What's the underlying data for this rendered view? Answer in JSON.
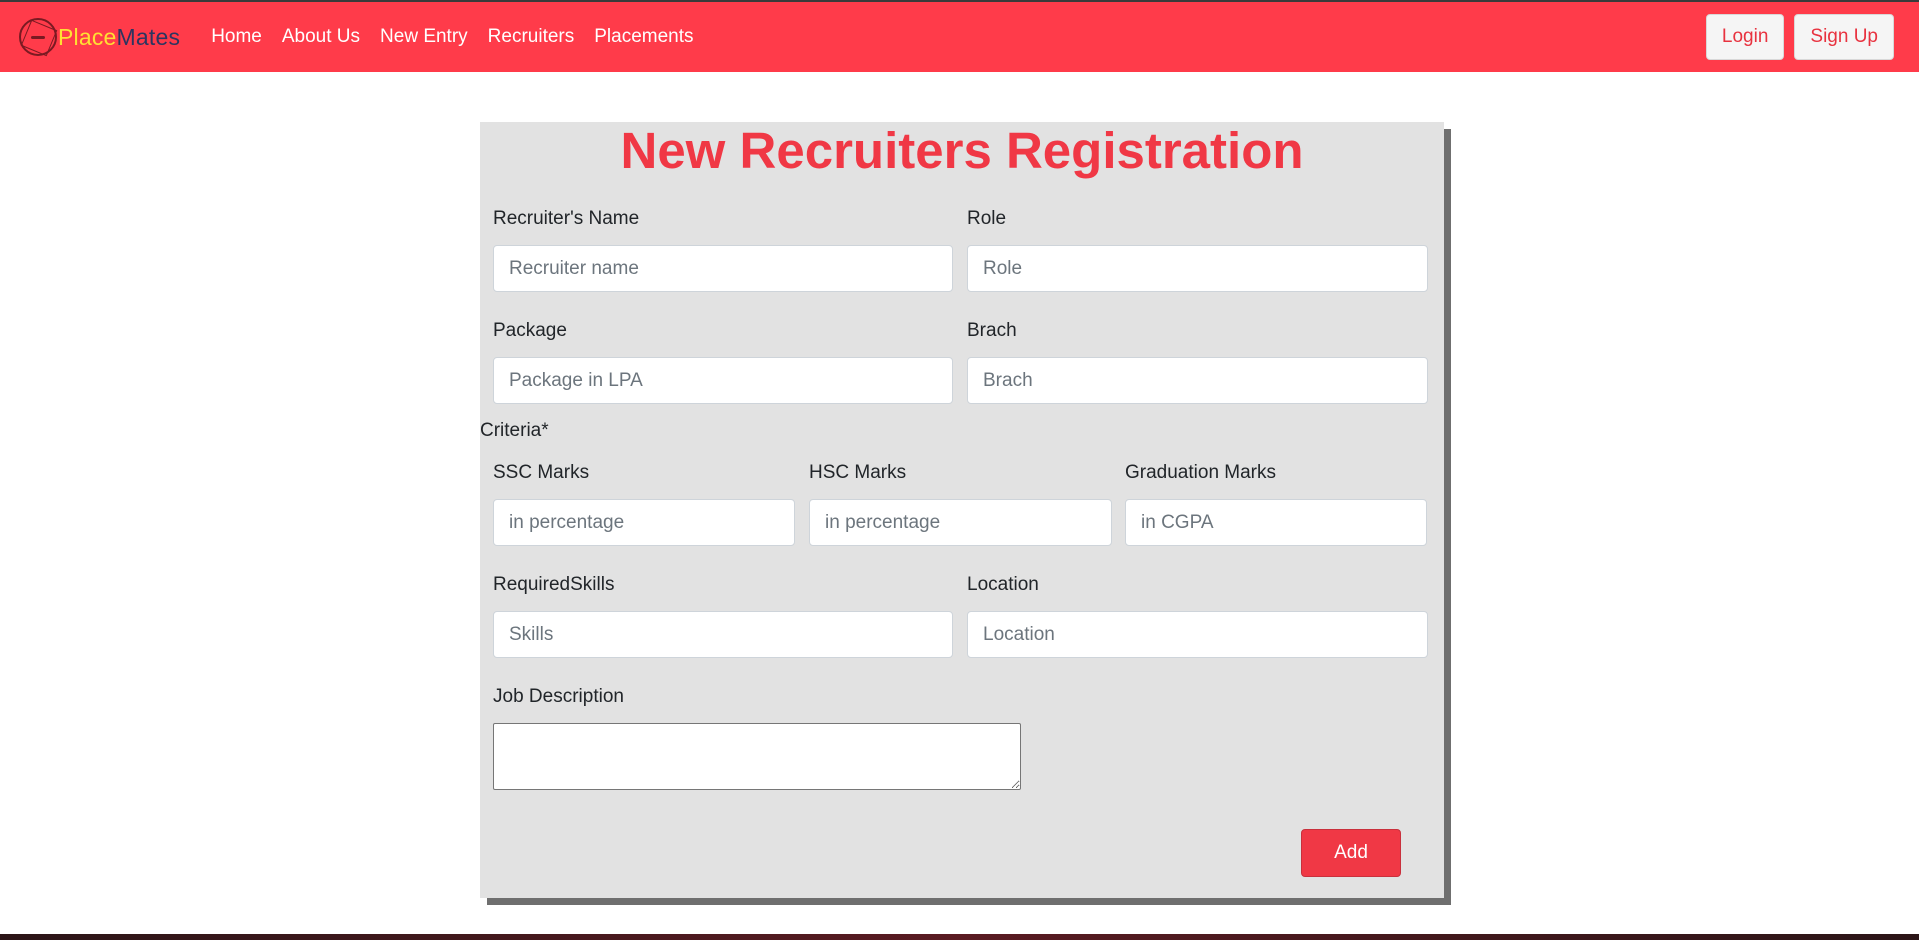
{
  "brand": {
    "part1": "Place",
    "part2": "Mates"
  },
  "nav": {
    "links": [
      "Home",
      "About Us",
      "New Entry",
      "Recruiters",
      "Placements"
    ],
    "login": "Login",
    "signup": "Sign Up"
  },
  "form": {
    "title": "New Recruiters Registration",
    "name_label": "Recruiter's Name",
    "name_placeholder": "Recruiter name",
    "role_label": "Role",
    "role_placeholder": "Role",
    "package_label": "Package",
    "package_placeholder": "Package in LPA",
    "branch_label": "Brach",
    "branch_placeholder": "Brach",
    "criteria_label": "Criteria*",
    "ssc_label": "SSC Marks",
    "ssc_placeholder": "in percentage",
    "hsc_label": "HSC Marks",
    "hsc_placeholder": "in percentage",
    "grad_label": "Graduation Marks",
    "grad_placeholder": "in CGPA",
    "skills_label": "RequiredSkills",
    "skills_placeholder": "Skills",
    "location_label": "Location",
    "location_placeholder": "Location",
    "desc_label": "Job Description",
    "add_button": "Add"
  },
  "colors": {
    "primary": "#ff3b4a",
    "title": "#f03845",
    "card": "#e2e2e2"
  }
}
